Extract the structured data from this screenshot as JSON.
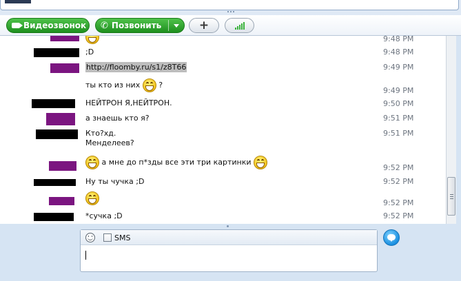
{
  "toolbar": {
    "video_call_label": "Видеозвонок",
    "call_label": "Позвонить",
    "add_label": "+"
  },
  "messages": [
    {
      "text": [
        ""
      ],
      "emoji": "grin",
      "time": "9:48 PM"
    },
    {
      "text": [
        ";D"
      ],
      "time": "9:48 PM"
    },
    {
      "text": [
        "http://floomby.ru/s1/z8T66"
      ],
      "time": "9:49 PM"
    },
    {
      "text": [
        "ты кто из них",
        "?"
      ],
      "time": "9:49 PM"
    },
    {
      "text": [
        "НЕЙТРОН Я,НЕЙТРОН."
      ],
      "time": "9:50 PM"
    },
    {
      "text": [
        "а знаешь кто я?"
      ],
      "time": "9:51 PM"
    },
    {
      "text": [
        "Кто?хд.",
        "Менделеев?"
      ],
      "time": "9:51 PM"
    },
    {
      "text": [
        "а мне до п*зды все эти три картинки"
      ],
      "time": "9:52 PM"
    },
    {
      "text": [
        "Ну ты чучка ;D"
      ],
      "time": "9:52 PM"
    },
    {
      "text": [
        ""
      ],
      "time": "9:52 PM"
    },
    {
      "text": [
        "*сучка ;D"
      ],
      "time": "9:52 PM"
    }
  ],
  "compose": {
    "sms_label": "SMS",
    "sms_checked": false
  },
  "colors": {
    "call_green": "#1e8f1f",
    "redact_black": "#000000",
    "redact_purple": "#7b1580",
    "time_gray": "#6d7580"
  }
}
